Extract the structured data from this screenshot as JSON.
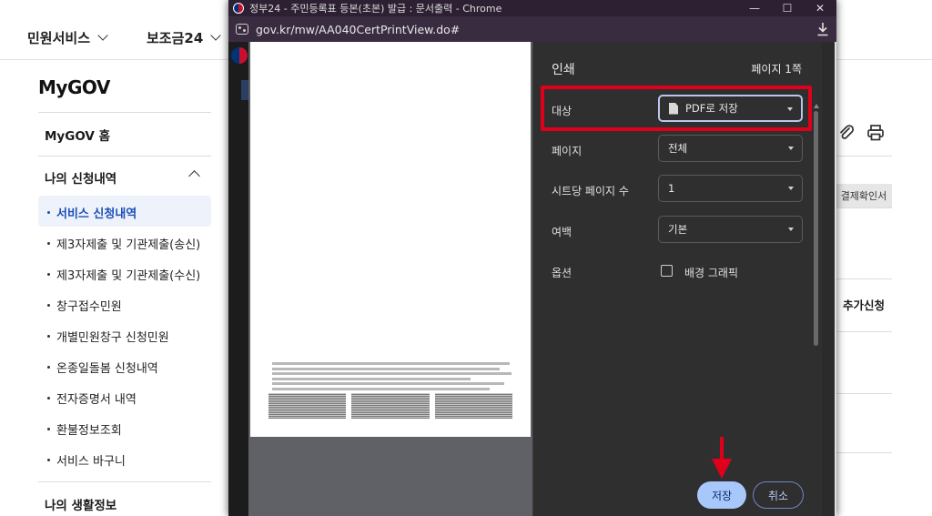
{
  "topnav": {
    "items": [
      {
        "label": "민원서비스"
      },
      {
        "label": "보조금24"
      }
    ]
  },
  "sidebar": {
    "brand": "MyGOV",
    "home": "MyGOV 홈",
    "group1": "나의 신청내역",
    "items": [
      {
        "label": "서비스 신청내역",
        "active": true
      },
      {
        "label": "제3자제출 및 기관제출(송신)"
      },
      {
        "label": "제3자제출 및 기관제출(수신)"
      },
      {
        "label": "창구접수민원"
      },
      {
        "label": "개별민원창구 신청민원"
      },
      {
        "label": "온종일돌봄 신청내역"
      },
      {
        "label": "전자증명서 내역"
      },
      {
        "label": "환불정보조회"
      },
      {
        "label": "서비스 바구니"
      }
    ],
    "group2": "나의 생활정보"
  },
  "rightpage": {
    "tag": "결제확인서",
    "add_label": "추가신청"
  },
  "popup": {
    "title": "정부24 - 주민등록표 등본(초본) 발급 : 문서출력 - Chrome",
    "url": "gov.kr/mw/AA040CertPrintView.do#",
    "controls": {
      "minimize": "—",
      "maximize": "☐",
      "close": "✕"
    }
  },
  "print": {
    "title": "인쇄",
    "pages_info": "페이지 1쪽",
    "destination_label": "대상",
    "destination_value": "PDF로 저장",
    "pages_label": "페이지",
    "pages_value": "전체",
    "per_sheet_label": "시트당 페이지 수",
    "per_sheet_value": "1",
    "margins_label": "여백",
    "margins_value": "기본",
    "options_label": "옵션",
    "bg_graphics_label": "배경 그래픽",
    "bg_graphics_checked": false,
    "save_label": "저장",
    "cancel_label": "취소"
  },
  "colors": {
    "highlight": "#e0001b",
    "save_button": "#a8c7fa",
    "active_menu": "#1b4fb8"
  }
}
